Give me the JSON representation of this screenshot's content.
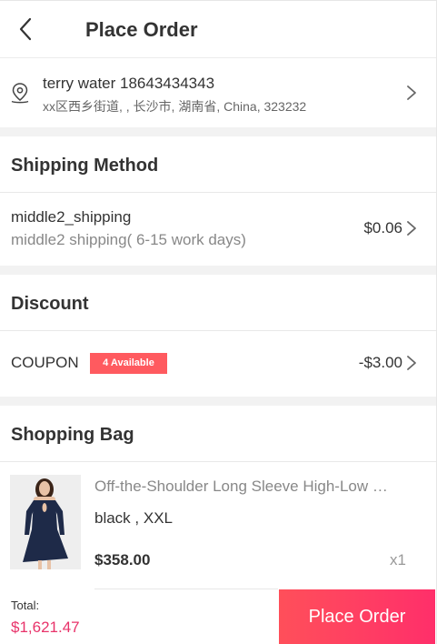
{
  "header": {
    "title": "Place Order"
  },
  "address": {
    "name_phone": "terry water 18643434343",
    "line": "xx区西乡街道, , 长沙市, 湖南省, China, 323232"
  },
  "shipping": {
    "title": "Shipping Method",
    "method_name": "middle2_shipping",
    "method_desc": "middle2 shipping( 6-15 work days)",
    "price": "$0.06"
  },
  "discount": {
    "title": "Discount",
    "coupon_label": "COUPON",
    "available_badge": "4 Available",
    "value": "-$3.00"
  },
  "bag": {
    "title": "Shopping Bag",
    "items": [
      {
        "name": "Off-the-Shoulder Long Sleeve High-Low …",
        "variant": "black , XXL",
        "price": "$358.00",
        "qty": "x1"
      }
    ]
  },
  "footer": {
    "total_label": "Total:",
    "total_value": "$1,621.47",
    "place_order_label": "Place Order"
  },
  "colors": {
    "accent": "#ff4f5a",
    "total": "#e8336a"
  }
}
